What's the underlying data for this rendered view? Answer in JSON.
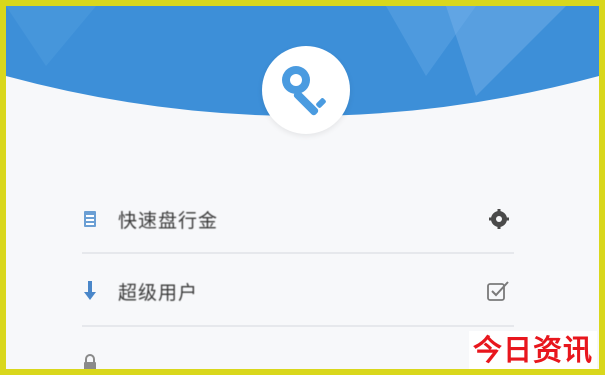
{
  "header": {
    "icon": "key-icon",
    "colors": {
      "banner": "#3d8fd8",
      "banner_light": "#79b4ec",
      "key": "#4a9be0"
    }
  },
  "settings": {
    "items": [
      {
        "icon": "document-icon",
        "label": "快速盘行金",
        "trail_icon": "gear-icon"
      },
      {
        "icon": "download-arrow-icon",
        "label": "超级用户",
        "trail_icon": "checkbox-checked-icon"
      },
      {
        "icon": "lock-icon",
        "label": "",
        "trail_icon": ""
      }
    ]
  },
  "watermark": {
    "text": "今日资讯",
    "color": "#e8161d"
  }
}
